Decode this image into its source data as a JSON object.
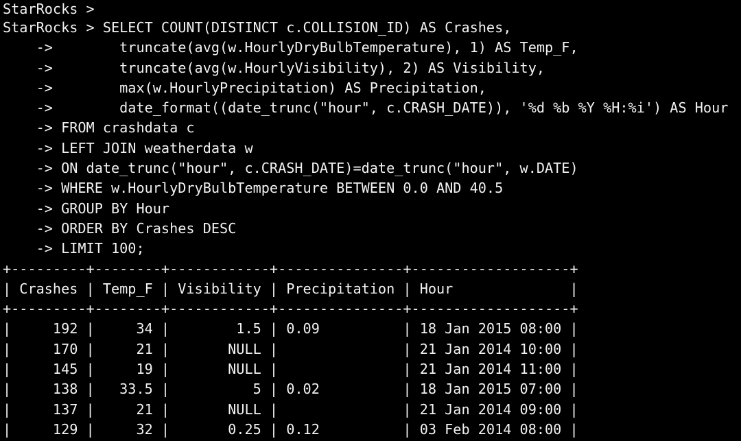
{
  "terminal": {
    "lines": [
      "StarRocks >",
      "StarRocks > SELECT COUNT(DISTINCT c.COLLISION_ID) AS Crashes,",
      "    ->        truncate(avg(w.HourlyDryBulbTemperature), 1) AS Temp_F,",
      "    ->        truncate(avg(w.HourlyVisibility), 2) AS Visibility,",
      "    ->        max(w.HourlyPrecipitation) AS Precipitation,",
      "    ->        date_format((date_trunc(\"hour\", c.CRASH_DATE)), '%d %b %Y %H:%i') AS Hour",
      "    -> FROM crashdata c",
      "    -> LEFT JOIN weatherdata w",
      "    -> ON date_trunc(\"hour\", c.CRASH_DATE)=date_trunc(\"hour\", w.DATE)",
      "    -> WHERE w.HourlyDryBulbTemperature BETWEEN 0.0 AND 40.5",
      "    -> GROUP BY Hour",
      "    -> ORDER BY Crashes DESC",
      "    -> LIMIT 100;",
      "+---------+--------+------------+---------------+-------------------+",
      "| Crashes | Temp_F | Visibility | Precipitation | Hour              |",
      "+---------+--------+------------+---------------+-------------------+",
      "|     192 |     34 |        1.5 | 0.09          | 18 Jan 2015 08:00 |",
      "|     170 |     21 |       NULL |               | 21 Jan 2014 10:00 |",
      "|     145 |     19 |       NULL |               | 21 Jan 2014 11:00 |",
      "|     138 |   33.5 |          5 | 0.02          | 18 Jan 2015 07:00 |",
      "|     137 |     21 |       NULL |               | 21 Jan 2014 09:00 |",
      "|     129 |     32 |       0.25 | 0.12          | 03 Feb 2014 08:00 |"
    ]
  }
}
